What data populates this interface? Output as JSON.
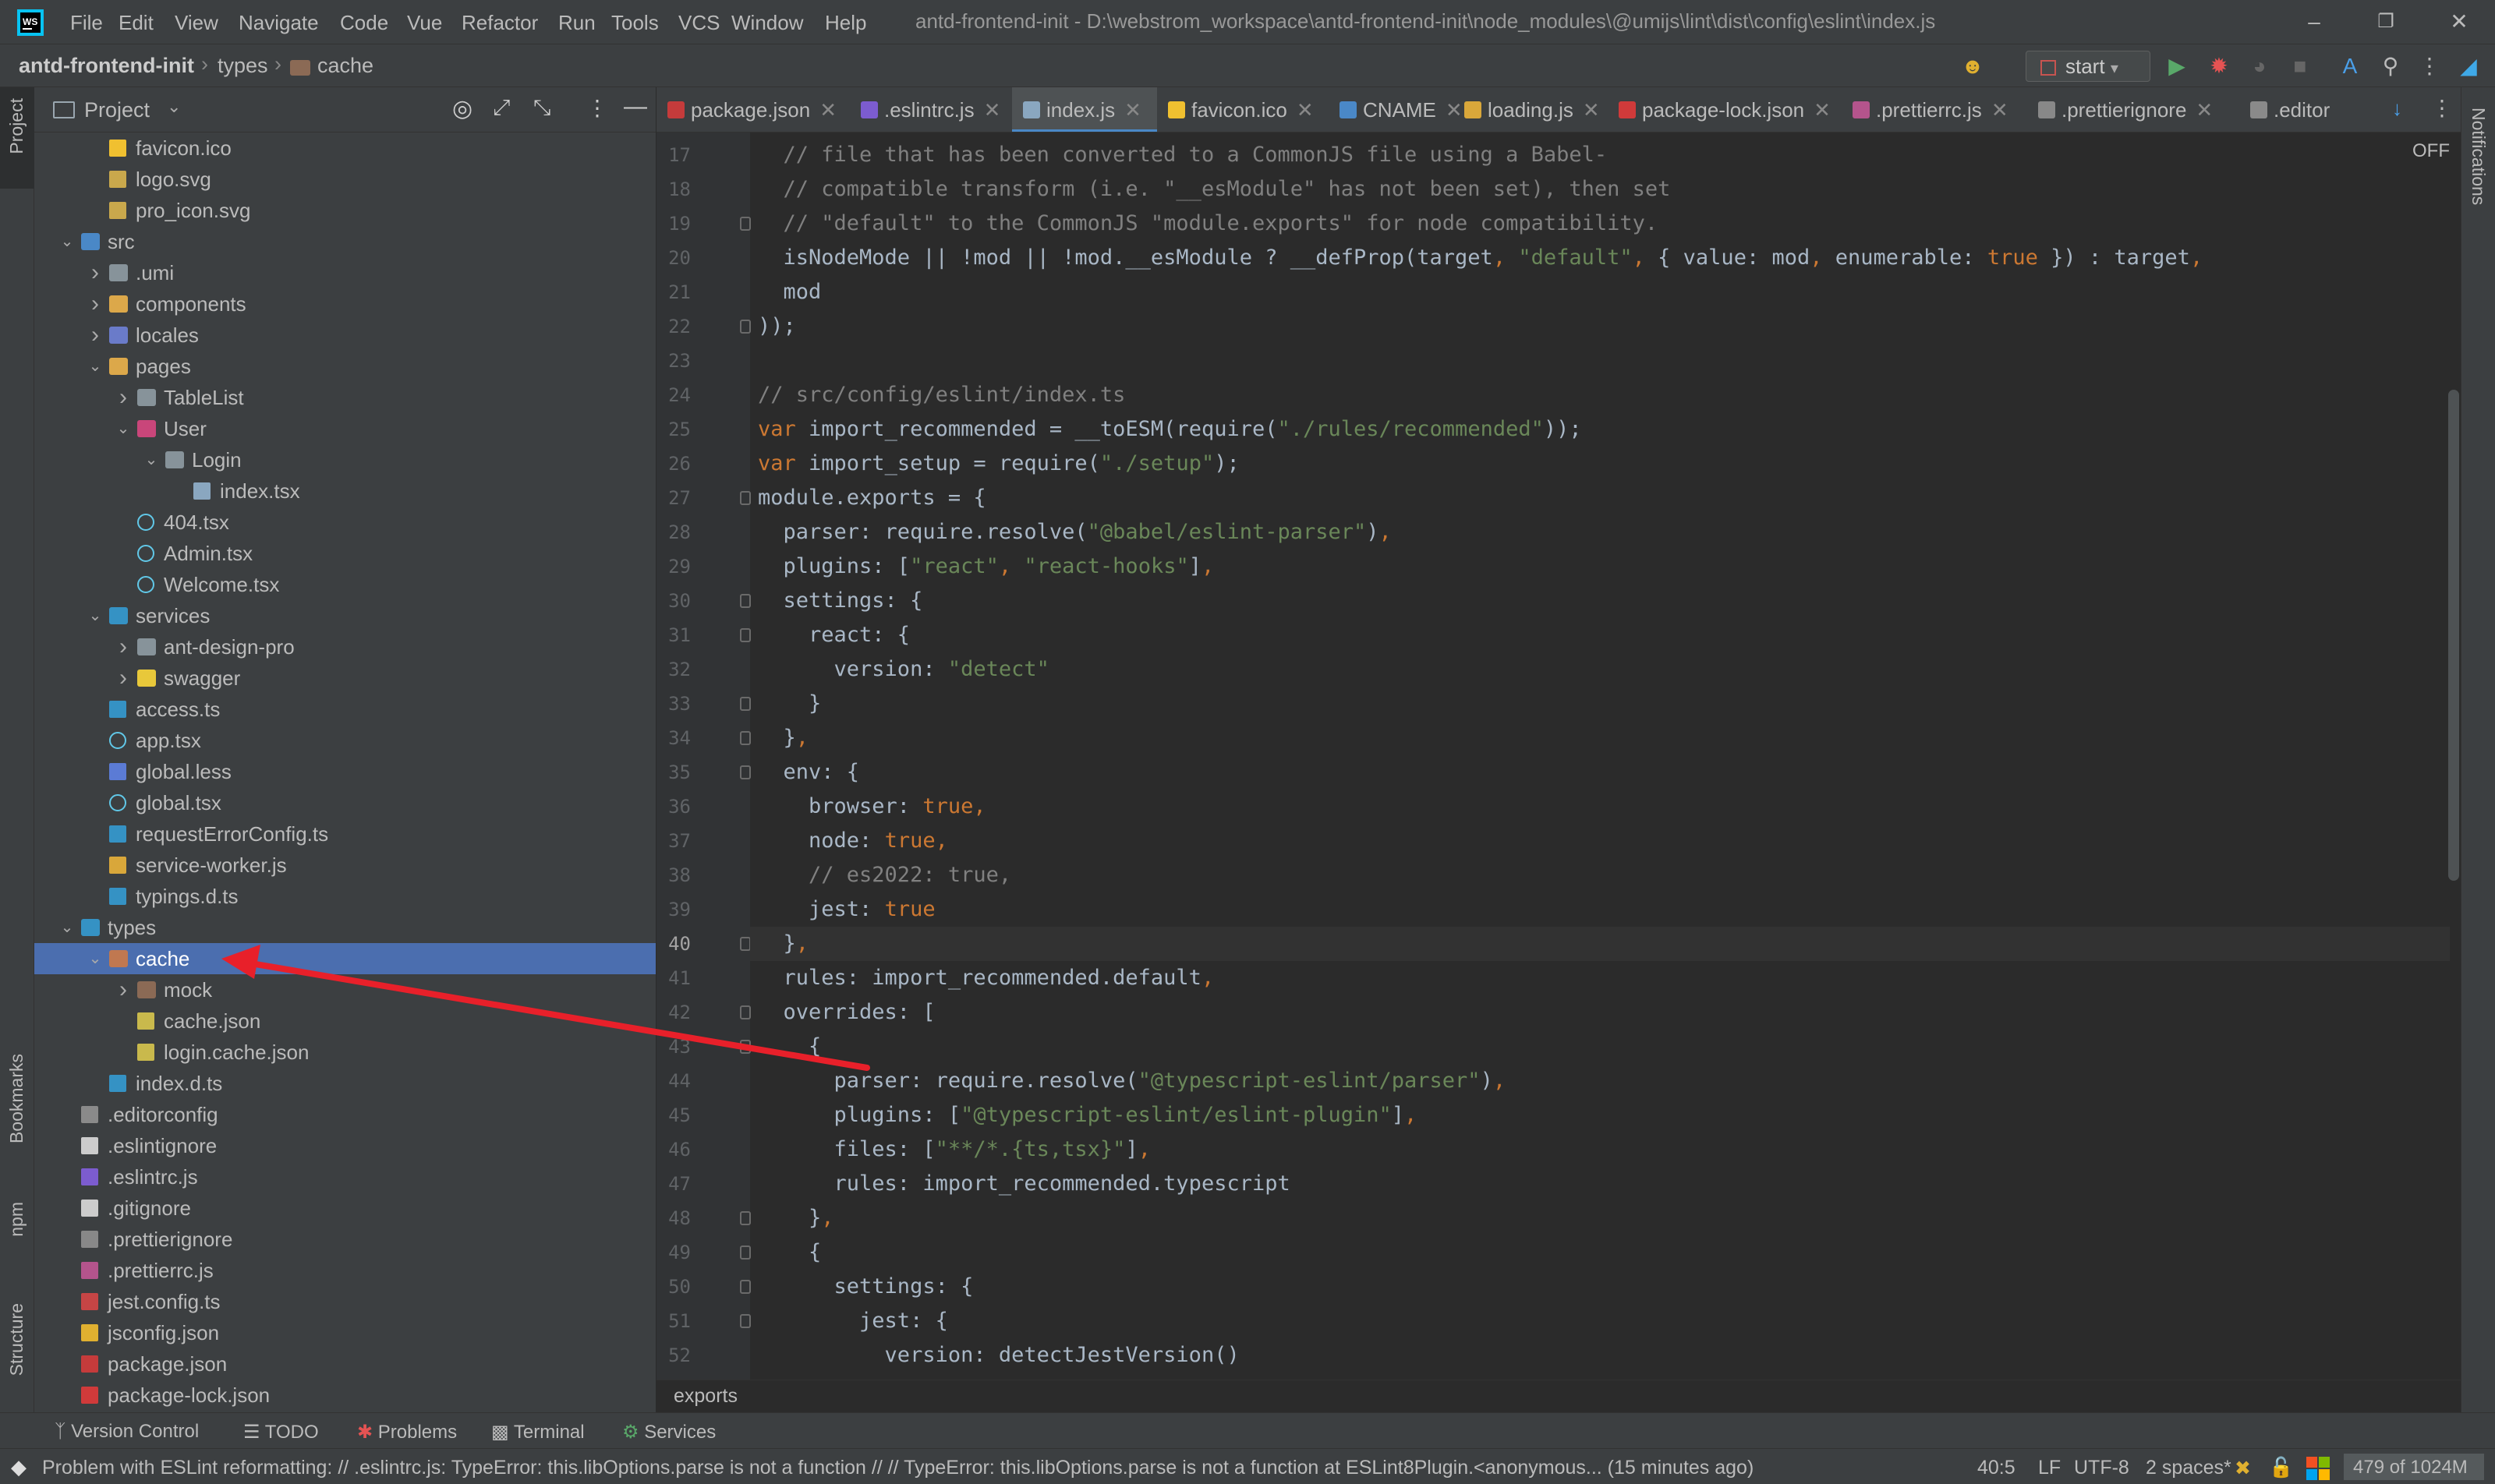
{
  "window": {
    "title": "antd-frontend-init - D:\\webstrom_workspace\\antd-frontend-init\\node_modules\\@umijs\\lint\\dist\\config\\eslint\\index.js",
    "menu": [
      "File",
      "Edit",
      "View",
      "Navigate",
      "Code",
      "Vue",
      "Refactor",
      "Run",
      "Tools",
      "VCS",
      "Window",
      "Help"
    ]
  },
  "navbar": {
    "breadcrumb": [
      "antd-frontend-init",
      "types",
      "cache"
    ],
    "run_config": "start"
  },
  "left_stripe": {
    "project": "Project",
    "bookmarks": "Bookmarks",
    "npm": "npm",
    "structure": "Structure"
  },
  "right_stripe": {
    "notifications": "Notifications"
  },
  "project_panel": {
    "title": "Project",
    "tree": [
      {
        "label": "favicon.ico",
        "icon": "star-icon",
        "color": "#f0c030",
        "indent": 2,
        "chev": ""
      },
      {
        "label": "logo.svg",
        "icon": "image-icon",
        "color": "#c9a84c",
        "indent": 2,
        "chev": ""
      },
      {
        "label": "pro_icon.svg",
        "icon": "image-icon",
        "color": "#c9a84c",
        "indent": 2,
        "chev": ""
      },
      {
        "label": "src",
        "icon": "source-folder-icon",
        "color": "#4a88c7",
        "indent": 1,
        "chev": "v"
      },
      {
        "label": ".umi",
        "icon": "folder-icon",
        "color": "#87939a",
        "indent": 2,
        "chev": ">"
      },
      {
        "label": "components",
        "icon": "folder-icon",
        "color": "#dca84a",
        "indent": 2,
        "chev": ">"
      },
      {
        "label": "locales",
        "icon": "folder-icon",
        "color": "#6a7bc9",
        "indent": 2,
        "chev": ">"
      },
      {
        "label": "pages",
        "icon": "folder-icon",
        "color": "#dca84a",
        "indent": 2,
        "chev": "v"
      },
      {
        "label": "TableList",
        "icon": "folder-icon",
        "color": "#87939a",
        "indent": 3,
        "chev": ">"
      },
      {
        "label": "User",
        "icon": "folder-icon",
        "color": "#c9467a",
        "indent": 3,
        "chev": "v"
      },
      {
        "label": "Login",
        "icon": "folder-icon",
        "color": "#87939a",
        "indent": 4,
        "chev": "v"
      },
      {
        "label": "index.tsx",
        "icon": "tsx-file-icon",
        "color": "#8aa7c0",
        "indent": 5,
        "chev": ""
      },
      {
        "label": "404.tsx",
        "icon": "react-icon",
        "color": "#61c8e8",
        "indent": 3,
        "chev": ""
      },
      {
        "label": "Admin.tsx",
        "icon": "react-icon",
        "color": "#61c8e8",
        "indent": 3,
        "chev": ""
      },
      {
        "label": "Welcome.tsx",
        "icon": "react-icon",
        "color": "#61c8e8",
        "indent": 3,
        "chev": ""
      },
      {
        "label": "services",
        "icon": "folder-icon",
        "color": "#3592c4",
        "indent": 2,
        "chev": "v"
      },
      {
        "label": "ant-design-pro",
        "icon": "folder-icon",
        "color": "#87939a",
        "indent": 3,
        "chev": ">"
      },
      {
        "label": "swagger",
        "icon": "folder-icon",
        "color": "#e8c83a",
        "indent": 3,
        "chev": ">"
      },
      {
        "label": "access.ts",
        "icon": "ts-file-icon",
        "color": "#3592c4",
        "indent": 2,
        "chev": ""
      },
      {
        "label": "app.tsx",
        "icon": "react-icon",
        "color": "#61c8e8",
        "indent": 2,
        "chev": ""
      },
      {
        "label": "global.less",
        "icon": "less-file-icon",
        "color": "#5b7bd5",
        "indent": 2,
        "chev": ""
      },
      {
        "label": "global.tsx",
        "icon": "react-icon",
        "color": "#61c8e8",
        "indent": 2,
        "chev": ""
      },
      {
        "label": "requestErrorConfig.ts",
        "icon": "ts-file-icon",
        "color": "#3592c4",
        "indent": 2,
        "chev": ""
      },
      {
        "label": "service-worker.js",
        "icon": "js-file-icon",
        "color": "#d9a73a",
        "indent": 2,
        "chev": ""
      },
      {
        "label": "typings.d.ts",
        "icon": "ts-file-icon",
        "color": "#3592c4",
        "indent": 2,
        "chev": ""
      },
      {
        "label": "types",
        "icon": "ts-folder-icon",
        "color": "#3592c4",
        "indent": 1,
        "chev": "v"
      },
      {
        "label": "cache",
        "icon": "excluded-folder-icon",
        "color": "#c07850",
        "indent": 2,
        "chev": "v",
        "selected": true
      },
      {
        "label": "mock",
        "icon": "excluded-folder-icon",
        "color": "#8b6a55",
        "indent": 3,
        "chev": ">"
      },
      {
        "label": "cache.json",
        "icon": "json-file-icon",
        "color": "#c9b94c",
        "indent": 3,
        "chev": ""
      },
      {
        "label": "login.cache.json",
        "icon": "json-file-icon",
        "color": "#c9b94c",
        "indent": 3,
        "chev": ""
      },
      {
        "label": "index.d.ts",
        "icon": "ts-file-icon",
        "color": "#3592c4",
        "indent": 2,
        "chev": ""
      },
      {
        "label": ".editorconfig",
        "icon": "gear-file-icon",
        "color": "#8a8a8a",
        "indent": 1,
        "chev": ""
      },
      {
        "label": ".eslintignore",
        "icon": "eslint-icon",
        "color": "#cccccc",
        "indent": 1,
        "chev": ""
      },
      {
        "label": ".eslintrc.js",
        "icon": "eslint-icon",
        "color": "#7c5ccf",
        "indent": 1,
        "chev": ""
      },
      {
        "label": ".gitignore",
        "icon": "git-icon",
        "color": "#cccccc",
        "indent": 1,
        "chev": ""
      },
      {
        "label": ".prettierignore",
        "icon": "prettier-icon",
        "color": "#888888",
        "indent": 1,
        "chev": ""
      },
      {
        "label": ".prettierrc.js",
        "icon": "prettier-icon",
        "color": "#b4548c",
        "indent": 1,
        "chev": ""
      },
      {
        "label": "jest.config.ts",
        "icon": "jest-icon",
        "color": "#c64545",
        "indent": 1,
        "chev": ""
      },
      {
        "label": "jsconfig.json",
        "icon": "config-icon",
        "color": "#e0b030",
        "indent": 1,
        "chev": ""
      },
      {
        "label": "package.json",
        "icon": "npm-icon",
        "color": "#c53b3b",
        "indent": 1,
        "chev": ""
      },
      {
        "label": "package-lock.json",
        "icon": "lock-icon",
        "color": "#d03a3a",
        "indent": 1,
        "chev": ""
      }
    ]
  },
  "editor_tabs": [
    {
      "label": "package.json",
      "icon": "npm-icon",
      "color": "#c53b3b"
    },
    {
      "label": ".eslintrc.js",
      "icon": "eslint-icon",
      "color": "#7c5ccf"
    },
    {
      "label": "index.js",
      "icon": "js-file-icon",
      "color": "#8aa7c0",
      "active": true
    },
    {
      "label": "favicon.ico",
      "icon": "star-icon",
      "color": "#f0c030"
    },
    {
      "label": "CNAME",
      "icon": "globe-icon",
      "color": "#4a88c7"
    },
    {
      "label": "loading.js",
      "icon": "js-file-icon",
      "color": "#d9a73a"
    },
    {
      "label": "package-lock.json",
      "icon": "lock-icon",
      "color": "#d03a3a"
    },
    {
      "label": ".prettierrc.js",
      "icon": "prettier-icon",
      "color": "#b4548c"
    },
    {
      "label": ".prettierignore",
      "icon": "prettier-icon",
      "color": "#888888"
    },
    {
      "label": ".editor",
      "icon": "gear-file-icon",
      "color": "#8a8a8a"
    }
  ],
  "editor": {
    "inspection_widget": "OFF",
    "current_line": 40,
    "lines": [
      {
        "n": 17,
        "fold": false,
        "segs": [
          [
            "cm",
            "  // file that has been converted to a CommonJS file using a Babel-"
          ]
        ]
      },
      {
        "n": 18,
        "fold": false,
        "segs": [
          [
            "cm",
            "  // compatible transform (i.e. \"__esModule\" has not been set), then set"
          ]
        ]
      },
      {
        "n": 19,
        "fold": true,
        "segs": [
          [
            "cm",
            "  // \"default\" to the CommonJS \"module.exports\" for node compatibility."
          ]
        ]
      },
      {
        "n": 20,
        "fold": false,
        "segs": [
          [
            "",
            "  isNodeMode || !mod || !mod.__esModule ? __defProp(target"
          ],
          [
            "kw",
            ", "
          ],
          [
            "st",
            "\"default\""
          ],
          [
            "kw",
            ", "
          ],
          [
            "",
            "{ value: mod"
          ],
          [
            "kw",
            ", "
          ],
          [
            "",
            "enumerable: "
          ],
          [
            "kw",
            "true"
          ],
          [
            "",
            " }) : target"
          ],
          [
            "kw",
            ","
          ]
        ]
      },
      {
        "n": 21,
        "fold": false,
        "segs": [
          [
            "",
            "  mod"
          ]
        ]
      },
      {
        "n": 22,
        "fold": true,
        "segs": [
          [
            "",
            "));"
          ]
        ]
      },
      {
        "n": 23,
        "fold": false,
        "segs": [
          [
            "",
            ""
          ]
        ]
      },
      {
        "n": 24,
        "fold": false,
        "segs": [
          [
            "cm",
            "// src/config/eslint/index.ts"
          ]
        ]
      },
      {
        "n": 25,
        "fold": false,
        "segs": [
          [
            "kw",
            "var "
          ],
          [
            "",
            "import_recommended = __toESM(require("
          ],
          [
            "st",
            "\"./rules/recommended\""
          ],
          [
            "",
            "));"
          ]
        ]
      },
      {
        "n": 26,
        "fold": false,
        "segs": [
          [
            "kw",
            "var "
          ],
          [
            "",
            "import_setup = require("
          ],
          [
            "st",
            "\"./setup\""
          ],
          [
            "",
            ");"
          ]
        ]
      },
      {
        "n": 27,
        "fold": true,
        "segs": [
          [
            "",
            "module.exports = {"
          ]
        ]
      },
      {
        "n": 28,
        "fold": false,
        "segs": [
          [
            "",
            "  parser: require.resolve("
          ],
          [
            "st",
            "\"@babel/eslint-parser\""
          ],
          [
            "",
            ")"
          ],
          [
            "kw",
            ","
          ]
        ]
      },
      {
        "n": 29,
        "fold": false,
        "segs": [
          [
            "",
            "  plugins: ["
          ],
          [
            "st",
            "\"react\""
          ],
          [
            "kw",
            ", "
          ],
          [
            "st",
            "\"react-hooks\""
          ],
          [
            "",
            "]"
          ],
          [
            "kw",
            ","
          ]
        ]
      },
      {
        "n": 30,
        "fold": true,
        "segs": [
          [
            "",
            "  settings: {"
          ]
        ]
      },
      {
        "n": 31,
        "fold": true,
        "segs": [
          [
            "",
            "    react: {"
          ]
        ]
      },
      {
        "n": 32,
        "fold": false,
        "segs": [
          [
            "",
            "      version: "
          ],
          [
            "st",
            "\"detect\""
          ]
        ]
      },
      {
        "n": 33,
        "fold": true,
        "segs": [
          [
            "",
            "    }"
          ]
        ]
      },
      {
        "n": 34,
        "fold": true,
        "segs": [
          [
            "",
            "  }"
          ],
          [
            "kw",
            ","
          ]
        ]
      },
      {
        "n": 35,
        "fold": true,
        "segs": [
          [
            "",
            "  env: {"
          ]
        ]
      },
      {
        "n": 36,
        "fold": false,
        "segs": [
          [
            "",
            "    browser: "
          ],
          [
            "kw",
            "true,"
          ]
        ]
      },
      {
        "n": 37,
        "fold": false,
        "segs": [
          [
            "",
            "    node: "
          ],
          [
            "kw",
            "true,"
          ]
        ]
      },
      {
        "n": 38,
        "fold": false,
        "segs": [
          [
            "cm",
            "    // es2022: true,"
          ]
        ]
      },
      {
        "n": 39,
        "fold": false,
        "segs": [
          [
            "",
            "    jest: "
          ],
          [
            "kw",
            "true"
          ]
        ]
      },
      {
        "n": 40,
        "fold": true,
        "segs": [
          [
            "",
            "  }"
          ],
          [
            "kw",
            ","
          ]
        ]
      },
      {
        "n": 41,
        "fold": false,
        "segs": [
          [
            "",
            "  rules: import_recommended.default"
          ],
          [
            "kw",
            ","
          ]
        ]
      },
      {
        "n": 42,
        "fold": true,
        "segs": [
          [
            "",
            "  overrides: ["
          ]
        ]
      },
      {
        "n": 43,
        "fold": true,
        "segs": [
          [
            "",
            "    {"
          ]
        ]
      },
      {
        "n": 44,
        "fold": false,
        "segs": [
          [
            "",
            "      parser: require.resolve("
          ],
          [
            "st",
            "\"@typescript-eslint/parser\""
          ],
          [
            "",
            ")"
          ],
          [
            "kw",
            ","
          ]
        ]
      },
      {
        "n": 45,
        "fold": false,
        "segs": [
          [
            "",
            "      plugins: ["
          ],
          [
            "st",
            "\"@typescript-eslint/eslint-plugin\""
          ],
          [
            "",
            "]"
          ],
          [
            "kw",
            ","
          ]
        ]
      },
      {
        "n": 46,
        "fold": false,
        "segs": [
          [
            "",
            "      files: ["
          ],
          [
            "st",
            "\"**/*.{ts,tsx}\""
          ],
          [
            "",
            "]"
          ],
          [
            "kw",
            ","
          ]
        ]
      },
      {
        "n": 47,
        "fold": false,
        "segs": [
          [
            "",
            "      rules: import_recommended.typescript"
          ]
        ]
      },
      {
        "n": 48,
        "fold": true,
        "segs": [
          [
            "",
            "    }"
          ],
          [
            "kw",
            ","
          ]
        ]
      },
      {
        "n": 49,
        "fold": true,
        "segs": [
          [
            "",
            "    {"
          ]
        ]
      },
      {
        "n": 50,
        "fold": true,
        "segs": [
          [
            "",
            "      settings: {"
          ]
        ]
      },
      {
        "n": 51,
        "fold": true,
        "segs": [
          [
            "",
            "        jest: {"
          ]
        ]
      },
      {
        "n": 52,
        "fold": false,
        "segs": [
          [
            "",
            "          version: detectJestVersion()"
          ]
        ]
      }
    ],
    "breadcrumb": "exports"
  },
  "tool_windows": [
    "Version Control",
    "TODO",
    "Problems",
    "Terminal",
    "Services"
  ],
  "status": {
    "message": "Problem with ESLint reformatting: // .eslintrc.js: TypeError: this.libOptions.parse is not a function // // TypeError: this.libOptions.parse is not a function    at ESLint8Plugin.<anonymous... (15 minutes ago)",
    "position": "40:5",
    "line_sep": "LF",
    "encoding": "UTF-8",
    "indent": "2 spaces*",
    "memory": "479 of 1024M"
  }
}
